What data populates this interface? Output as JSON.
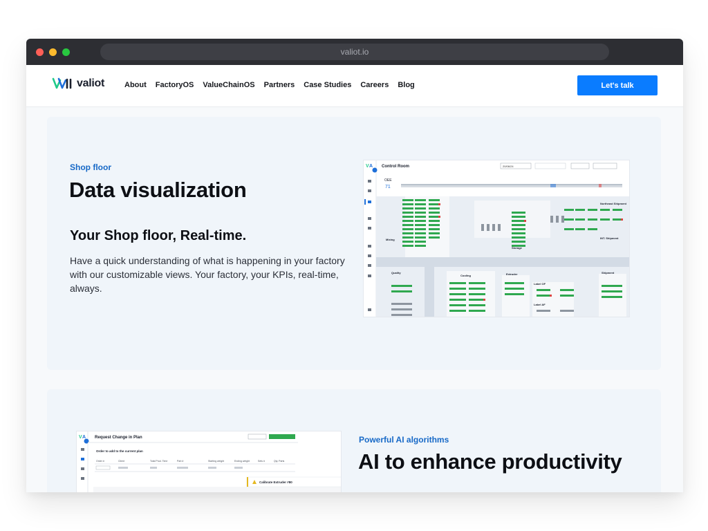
{
  "browser": {
    "url": "valiot.io"
  },
  "nav": {
    "logo_text": "valiot",
    "items": [
      "About",
      "FactoryOS",
      "ValueChainOS",
      "Partners",
      "Case Studies",
      "Careers",
      "Blog"
    ],
    "cta_label": "Let's talk"
  },
  "section1": {
    "eyebrow": "Shop floor",
    "title": "Data visualization",
    "subtitle": "Your Shop floor, Real-time.",
    "description": "Have a quick understanding of what is happening in your factory with our customizable views. Your factory, your KPIs, real-time, always.",
    "screenshot": {
      "title": "Control Room",
      "date": "20/06/24",
      "kpi_label": "OEE",
      "kpi_value": "71",
      "areas": [
        "Mixing",
        "Storage",
        "Northeast Shipment",
        "INT. Shipment",
        "Quality",
        "Cooling",
        "Extruder",
        "Label OF",
        "Label AF",
        "Shipment"
      ]
    }
  },
  "section2": {
    "eyebrow": "Powerful AI algorithms",
    "title": "AI to enhance productivity",
    "screenshot": {
      "title": "Request Change in Plan",
      "subtitle": "Order to add to the current plan",
      "columns": [
        "Order #",
        "Client",
        "Total Prod. Time",
        "Part #",
        "Starting weight",
        "Ending weight",
        "Sets #",
        "Qty. Parts"
      ],
      "alert": "Calibrate Extruder #80"
    }
  },
  "colors": {
    "accent": "#0a7cff",
    "eyebrow": "#1769c7",
    "logo_green": "#1fc98a",
    "logo_blue": "#1e6fd9"
  }
}
